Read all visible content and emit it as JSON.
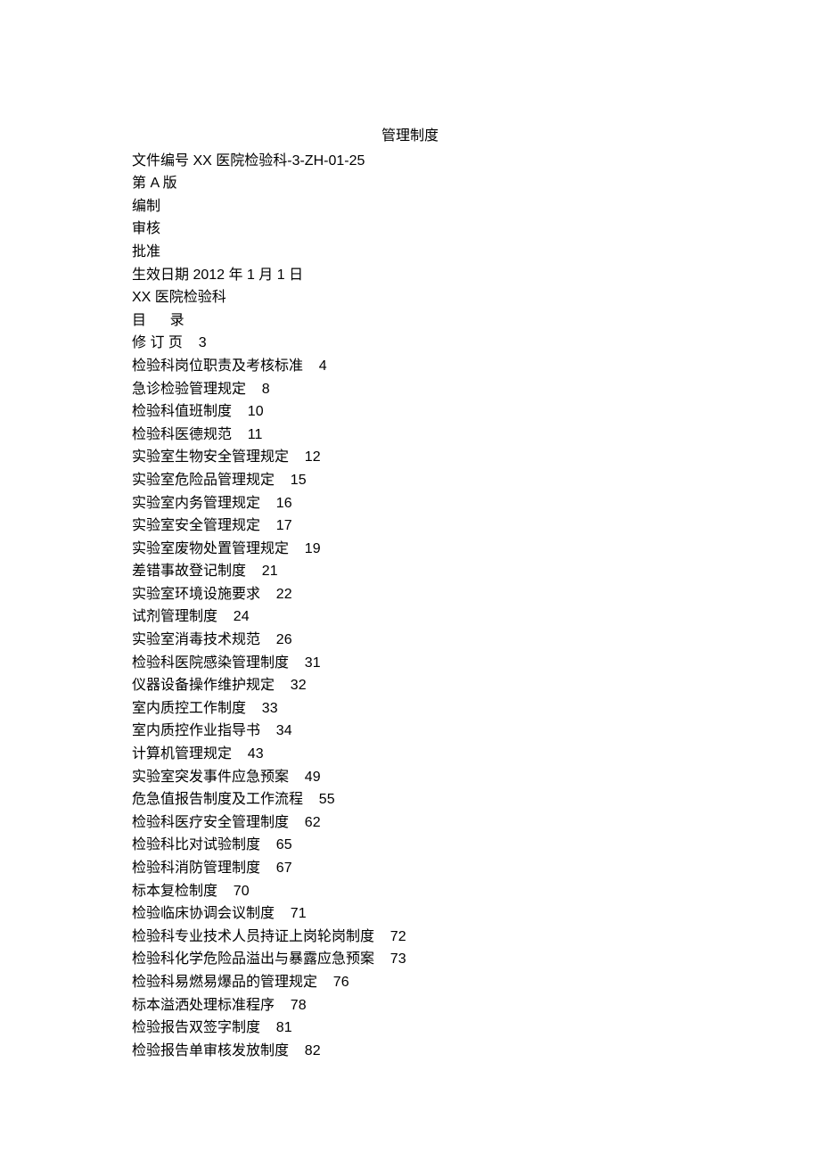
{
  "title": "管理制度",
  "meta": {
    "doc_number_label": "文件编号 ",
    "doc_number_value": "XX 医院检验科-3-ZH-01-25",
    "version": "第 A 版",
    "prepared": "编制",
    "reviewed": "审核",
    "approved": "批准",
    "effective_date_label": "生效日期 ",
    "effective_date_value": "2012 年 1 月 1 日",
    "department": "XX 医院检验科"
  },
  "toc_heading": "目      录",
  "toc": [
    {
      "label": "修 订 页",
      "page": "3"
    },
    {
      "label": "检验科岗位职责及考核标准",
      "page": "4"
    },
    {
      "label": "急诊检验管理规定",
      "page": "8"
    },
    {
      "label": "检验科值班制度",
      "page": "10"
    },
    {
      "label": "检验科医德规范",
      "page": "11"
    },
    {
      "label": "实验室生物安全管理规定",
      "page": "12"
    },
    {
      "label": "实验室危险品管理规定",
      "page": "15"
    },
    {
      "label": "实验室内务管理规定",
      "page": "16"
    },
    {
      "label": "实验室安全管理规定",
      "page": "17"
    },
    {
      "label": "实验室废物处置管理规定",
      "page": "19"
    },
    {
      "label": "差错事故登记制度",
      "page": "21"
    },
    {
      "label": "实验室环境设施要求",
      "page": "22"
    },
    {
      "label": "试剂管理制度",
      "page": "24"
    },
    {
      "label": "实验室消毒技术规范",
      "page": "26"
    },
    {
      "label": "检验科医院感染管理制度",
      "page": "31"
    },
    {
      "label": "仪器设备操作维护规定",
      "page": "32"
    },
    {
      "label": "室内质控工作制度",
      "page": "33"
    },
    {
      "label": "室内质控作业指导书",
      "page": "34"
    },
    {
      "label": "计算机管理规定",
      "page": "43"
    },
    {
      "label": "实验室突发事件应急预案",
      "page": "49"
    },
    {
      "label": "危急值报告制度及工作流程",
      "page": "55"
    },
    {
      "label": "检验科医疗安全管理制度",
      "page": "62"
    },
    {
      "label": "检验科比对试验制度",
      "page": "65"
    },
    {
      "label": "检验科消防管理制度",
      "page": "67"
    },
    {
      "label": "标本复检制度",
      "page": "70"
    },
    {
      "label": "检验临床协调会议制度",
      "page": "71"
    },
    {
      "label": "检验科专业技术人员持证上岗轮岗制度",
      "page": "72"
    },
    {
      "label": "检验科化学危险品溢出与暴露应急预案",
      "page": "73"
    },
    {
      "label": "检验科易燃易爆品的管理规定",
      "page": "76"
    },
    {
      "label": "标本溢洒处理标准程序",
      "page": "78"
    },
    {
      "label": "检验报告双签字制度",
      "page": "81"
    },
    {
      "label": "检验报告单审核发放制度",
      "page": "82"
    }
  ]
}
